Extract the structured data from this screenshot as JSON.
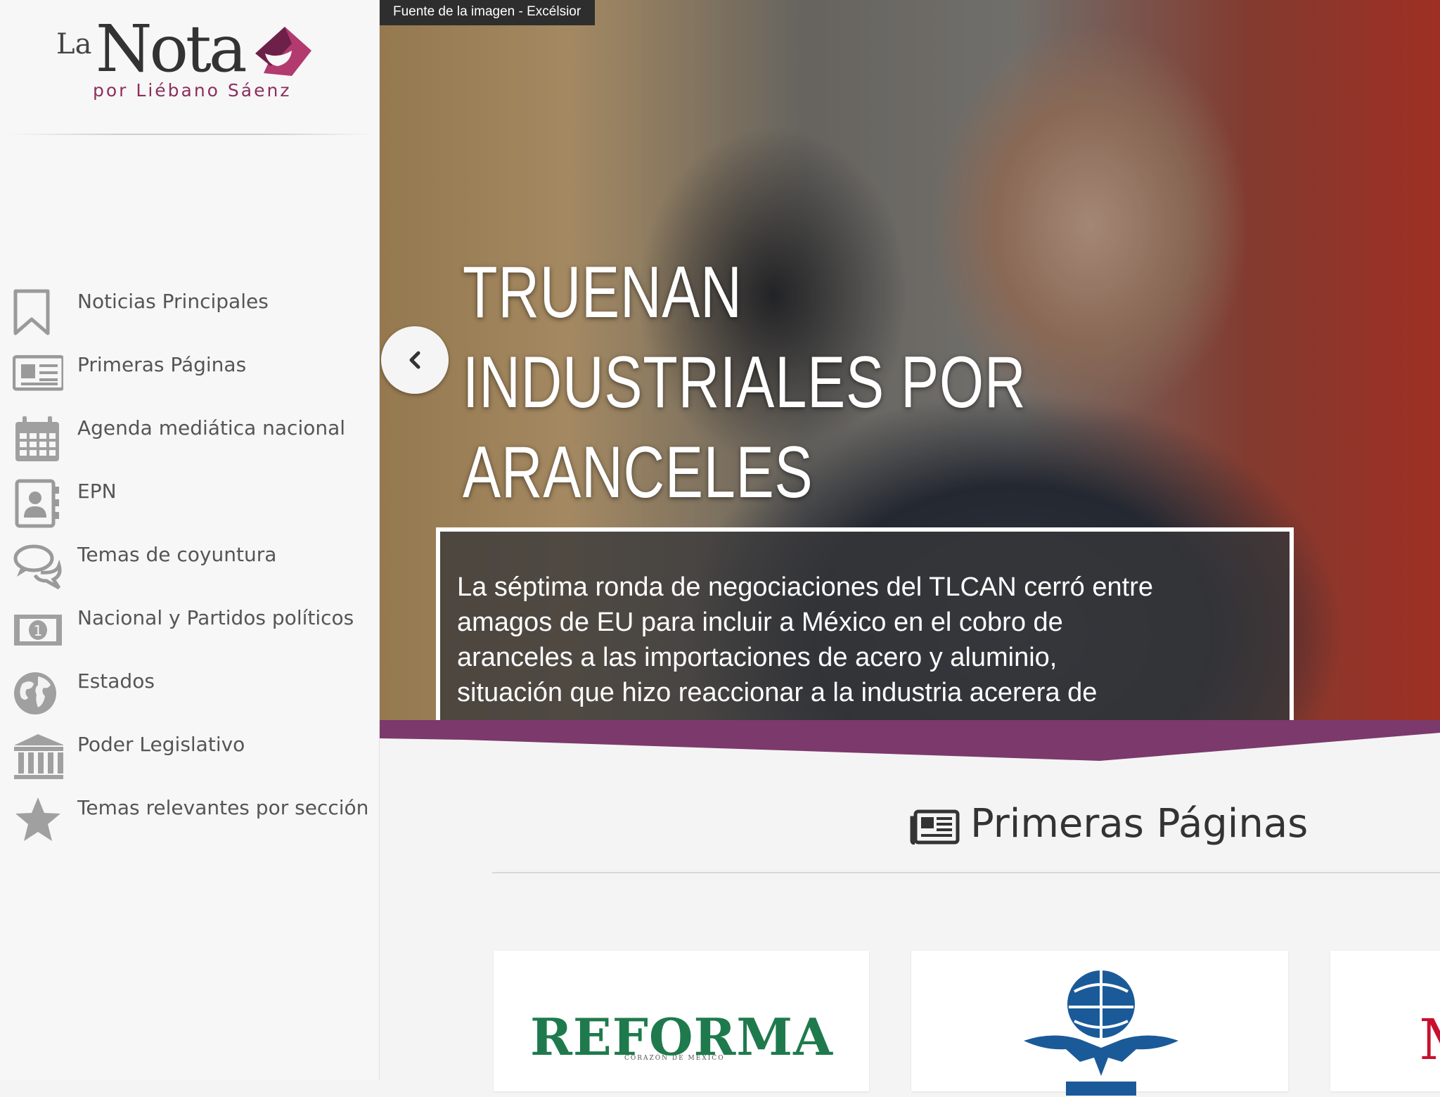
{
  "brand": {
    "la": "La",
    "nota": "Nota",
    "tagline": "por Liébano Sáenz",
    "accent": "#8c2f5c"
  },
  "sidebar": {
    "items": [
      {
        "label": "Noticias Principales",
        "icon": "bookmark-icon"
      },
      {
        "label": "Primeras Páginas",
        "icon": "newspaper-icon"
      },
      {
        "label": "Agenda mediática nacional",
        "icon": "calendar-icon"
      },
      {
        "label": "EPN",
        "icon": "contact-card-icon"
      },
      {
        "label": "Temas de coyuntura",
        "icon": "chat-bubbles-icon"
      },
      {
        "label": "Nacional y Partidos políticos",
        "icon": "banknote-icon"
      },
      {
        "label": "Estados",
        "icon": "globe-icon"
      },
      {
        "label": "Poder Legislativo",
        "icon": "institution-icon"
      },
      {
        "label": "Temas relevantes por sección",
        "icon": "star-icon"
      }
    ]
  },
  "hero": {
    "image_credit": "Fuente de la imagen - Excélsior",
    "headline": "TRUENAN INDUSTRIALES POR ARANCELES",
    "summary": "La séptima ronda de negociaciones del TLCAN cerró entre amagos de EU para incluir a México en el cobro de aranceles a las importaciones de acero y aluminio, situación que hizo reaccionar a la industria acerera de"
  },
  "section": {
    "title": "Primeras Páginas",
    "icon": "newspaper-icon",
    "divider_color": "#7b3a6b"
  },
  "cards": [
    {
      "name": "REFORMA",
      "subtitle": "CORAZÓN DE MÉXICO",
      "color": "#1e7a4c"
    },
    {
      "name": "",
      "emblem": "globe-eagle-icon",
      "color": "#1a5a99"
    },
    {
      "name": "M",
      "color": "#c8102e"
    }
  ]
}
